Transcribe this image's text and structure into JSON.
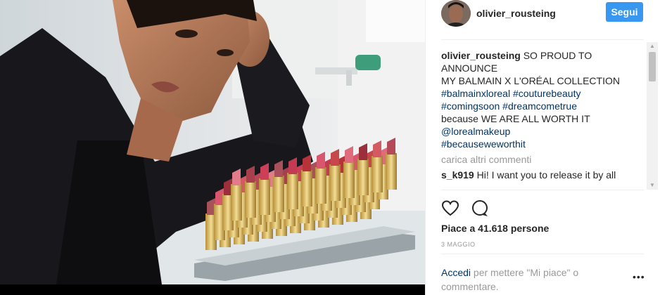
{
  "post": {
    "username": "olivier_rousteing",
    "follow_label": "Segui",
    "caption_lines": [
      "SO PROUD TO",
      "ANNOUNCE",
      "MY BALMAIN X L'ORÉAL COLLECTION"
    ],
    "hashtags_1": [
      "#balmainxloreal",
      "#couturebeauty"
    ],
    "hashtags_2": [
      "#comingsoon",
      "#dreamcometrue"
    ],
    "caption_line_worth": "because WE ARE ALL WORTH IT",
    "mention": "@lorealmakeup",
    "hashtag_3": "#becauseweworthit",
    "load_more": "carica altri commenti",
    "comment": {
      "username": "s_k919",
      "text": "Hi! I want you to release it by all"
    },
    "likes": "Piace a 41.618 persone",
    "date": "3 MAGGIO",
    "login_link": "Accedi",
    "login_text": "per mettere \"Mi piace\" o commentare.",
    "more_options": "•••"
  },
  "icons": {
    "like": "heart-icon",
    "comment": "comment-icon"
  },
  "colors": {
    "follow_button": "#3897f0",
    "link": "#003569",
    "muted": "#999999"
  }
}
